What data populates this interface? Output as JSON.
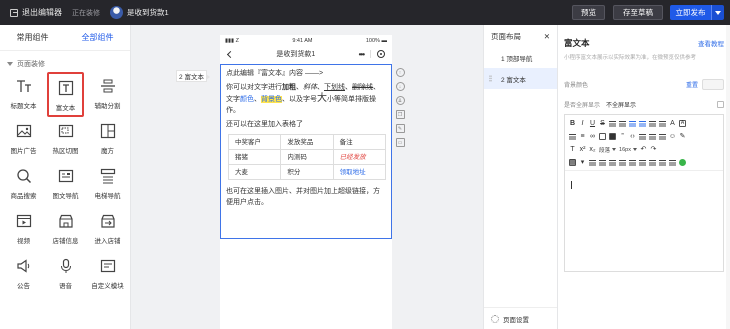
{
  "topbar": {
    "exit_label": "退出编辑器",
    "status": "正在装修",
    "shop_name": "是收到货款1",
    "preview_label": "预览",
    "save_draft_label": "存至草稿",
    "publish_label": "立即发布"
  },
  "left_panel": {
    "tabs": [
      "常用组件",
      "全部组件"
    ],
    "active_tab": "全部组件",
    "section_title": "页面装修",
    "components": [
      {
        "label": "标题文本",
        "icon": "title-text-icon"
      },
      {
        "label": "富文本",
        "icon": "rich-text-icon",
        "selected": true
      },
      {
        "label": "辅助分割",
        "icon": "divider-icon"
      },
      {
        "label": "图片广告",
        "icon": "image-ad-icon"
      },
      {
        "label": "热区切图",
        "icon": "hotspot-icon"
      },
      {
        "label": "魔方",
        "icon": "cube-icon"
      },
      {
        "label": "商品搜索",
        "icon": "search-icon"
      },
      {
        "label": "图文导航",
        "icon": "image-nav-icon"
      },
      {
        "label": "电梯导航",
        "icon": "elevator-nav-icon"
      },
      {
        "label": "视频",
        "icon": "video-icon"
      },
      {
        "label": "店铺信息",
        "icon": "shop-info-icon"
      },
      {
        "label": "进入店铺",
        "icon": "enter-shop-icon"
      },
      {
        "label": "公告",
        "icon": "notice-icon"
      },
      {
        "label": "语音",
        "icon": "voice-icon"
      },
      {
        "label": "自定义模块",
        "icon": "custom-module-icon"
      }
    ]
  },
  "canvas": {
    "side_tag": "2 富文本",
    "status_left": "▮▮▮ Z",
    "status_time": "9:41 AM",
    "status_right": "100% ▬",
    "nav_title": "是收到货款1",
    "rich": {
      "line1": "点此编辑『富文本』内容 ——>",
      "p2_a": "你可以对文字进行",
      "p2_bold": "加粗",
      "p2_sep1": "、",
      "p2_italic": "斜体",
      "p2_sep2": "、",
      "p2_underline": "下划线",
      "p2_sep3": "、",
      "p2_strike": "删除线",
      "p2_b": "、文字",
      "p2_color": "颜色",
      "p2_c": "、",
      "p2_bg": "背景色",
      "p2_d": "、以及字号",
      "p2_big": "大",
      "p2_e": "小等简单排版操作。",
      "p3": "还可以在这里加入表格了",
      "table": [
        [
          "中奖客户",
          "发放奖品",
          "备注"
        ],
        [
          "猪猪",
          "内测码",
          "已经发放"
        ],
        [
          "大麦",
          "积分",
          "领取地址"
        ]
      ],
      "p4": "也可在这里插入图片、并对图片加上超级链接，方便用户点击。"
    }
  },
  "layout_panel": {
    "title": "页面布局",
    "items": [
      "1 顶部导航",
      "2 富文本"
    ],
    "active_index": 1,
    "footer": "页面设置"
  },
  "right_panel": {
    "title": "富文本",
    "help_link": "查看教程",
    "description": "小程序富文本展示以实际效果为准，在微预览仅供参考",
    "bg_color_label": "背景颜色",
    "reset_label": "重置",
    "fullscreen_label": "是否全屏显示",
    "fullscreen_value": "不全屏显示",
    "font_format": "段落",
    "font_size": "16px"
  },
  "colors": {
    "accent": "#1f5ae8",
    "topbar_bg": "#26262b",
    "highlight_red": "#e0403b"
  }
}
